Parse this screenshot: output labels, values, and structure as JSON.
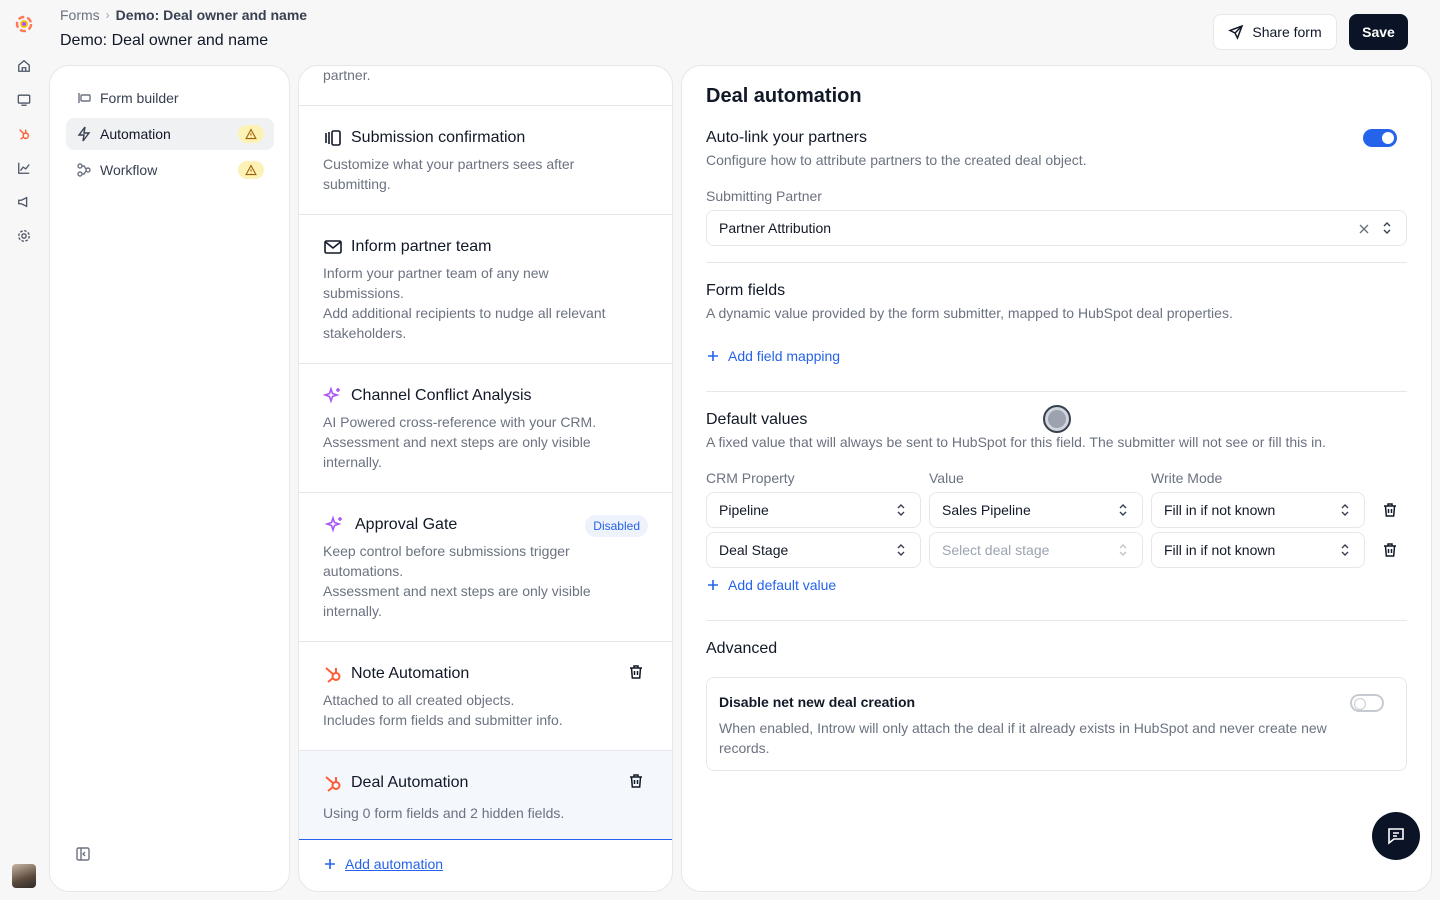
{
  "breadcrumb": {
    "root": "Forms",
    "current": "Demo: Deal owner and name"
  },
  "page_title": "Demo: Deal owner and name",
  "header": {
    "share_label": "Share form",
    "save_label": "Save"
  },
  "nav": {
    "items": [
      {
        "label": "Form builder",
        "icon": "form-builder-icon"
      },
      {
        "label": "Automation",
        "icon": "lightning-icon",
        "active": true,
        "warning": true
      },
      {
        "label": "Workflow",
        "icon": "workflow-icon",
        "warning": true
      }
    ]
  },
  "automations": {
    "top_text": "partner.",
    "cards": [
      {
        "title": "Submission confirmation",
        "desc": [
          "Customize what your partners sees after",
          "submitting."
        ]
      },
      {
        "title": "Inform partner team",
        "desc": [
          "Inform your partner team of any new",
          "submissions.",
          "Add additional recipients to nudge all relevant",
          "stakeholders."
        ]
      },
      {
        "title": "Channel Conflict Analysis",
        "desc": [
          "AI Powered cross-reference with your CRM.",
          "Assessment and next steps are only visible",
          "internally."
        ]
      },
      {
        "title": "Approval Gate",
        "badge": "Disabled",
        "desc": [
          "Keep control before submissions trigger",
          "automations.",
          "Assessment and next steps are only visible",
          "internally."
        ]
      },
      {
        "title": "Note Automation",
        "desc": [
          "Attached to all created objects.",
          "Includes form fields and submitter info."
        ]
      },
      {
        "title": "Deal Automation",
        "desc": [
          "Using 0 form fields and 2 hidden fields."
        ]
      }
    ],
    "add_label": "Add automation"
  },
  "deal": {
    "heading": "Deal automation",
    "autolink": {
      "title": "Auto-link your partners",
      "desc": "Configure how to attribute partners to the created deal object.",
      "enabled": true
    },
    "submitting_partner": {
      "label": "Submitting Partner",
      "value": "Partner Attribution"
    },
    "form_fields": {
      "title": "Form fields",
      "desc": "A dynamic value provided by the form submitter, mapped to HubSpot deal properties.",
      "add_label": "Add field mapping"
    },
    "default_values": {
      "title": "Default values",
      "desc": "A fixed value that will always be sent to HubSpot for this field. The submitter will not see or fill this in.",
      "columns": [
        "CRM Property",
        "Value",
        "Write Mode"
      ],
      "rows": [
        {
          "property": "Pipeline",
          "value": "Sales Pipeline",
          "mode": "Fill in if not known"
        },
        {
          "property": "Deal Stage",
          "value": "Select deal stage",
          "mode": "Fill in if not known"
        }
      ],
      "add_label": "Add default value"
    },
    "advanced": {
      "title": "Advanced",
      "option_title": "Disable net new deal creation",
      "option_desc": "When enabled, Introw will only attach the deal if it already exists in HubSpot and never create new records.",
      "enabled": false
    }
  },
  "colors": {
    "accent": "#2563eb",
    "primary_dark": "#0b1426",
    "hubspot": "#ff5c35",
    "ai_purple": "#a855f7",
    "warning_bg": "#fdf2b6"
  }
}
